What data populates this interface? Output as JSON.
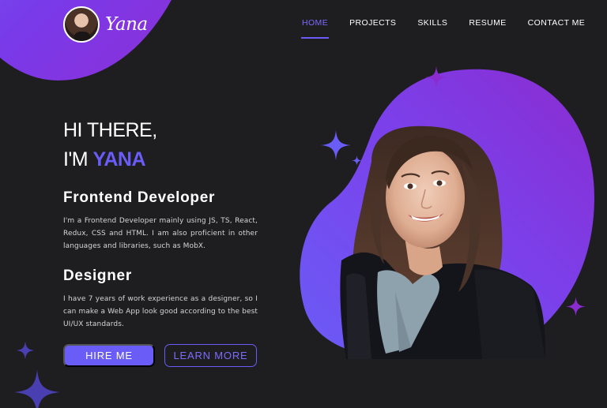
{
  "logo": {
    "name": "Yana",
    "avatar": "portrait-avatar"
  },
  "nav": {
    "items": [
      {
        "label": "HOME",
        "active": true
      },
      {
        "label": "PROJECTS",
        "active": false
      },
      {
        "label": "SKILLS",
        "active": false
      },
      {
        "label": "RESUME",
        "active": false
      },
      {
        "label": "CONTACT ME",
        "active": false
      }
    ]
  },
  "hero": {
    "greeting": "HI THERE,",
    "intro_prefix": "I'M ",
    "name": "YANA",
    "roles": [
      {
        "title": "Frontend Developer",
        "description": "I'm a Frontend Developer mainly using JS, TS, React, Redux, CSS and HTML. I am also proficient in other languages and libraries, such as MobX."
      },
      {
        "title": "Designer",
        "description": "I have 7 years of work experience as a designer, so I can make a Web App look good according to the best UI/UX standards."
      }
    ],
    "primary_button": "HIRE ME",
    "secondary_button": "LEARN MORE"
  },
  "colors": {
    "background": "#1e1d20",
    "accent": "#6a5cf6",
    "gradient_end": "#8e2fd4",
    "text": "#ffffff"
  },
  "icons": [
    "sparkle-icon"
  ]
}
